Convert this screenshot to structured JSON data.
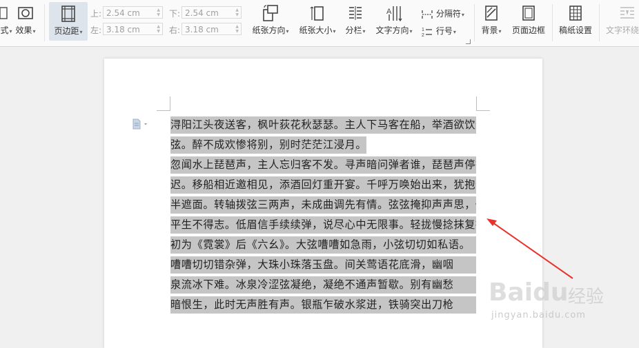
{
  "toolbar": {
    "left_label": "式",
    "effects_label": "效果",
    "margins_label": "页边距",
    "margins": {
      "top_label": "上:",
      "top_value": "2.54 cm",
      "bottom_label": "下:",
      "bottom_value": "2.54 cm",
      "left_label": "左:",
      "left_value": "3.18 cm",
      "right_label": "右:",
      "right_value": "3.18 cm"
    },
    "orientation_label": "纸张方向",
    "paper_size_label": "纸张大小",
    "columns_label": "分栏",
    "text_direction_label": "文字方向",
    "breaks_label": "分隔符",
    "line_numbers_label": "行号",
    "background_label": "背景",
    "page_border_label": "页面边框",
    "manuscript_label": "稿纸设置",
    "text_wrap_label": "文字环绕"
  },
  "document": {
    "lines": [
      {
        "text": "浔阳江头夜送客，枫叶荻花秋瑟瑟。主人下马客在船，举酒欲饮无管",
        "full": true
      },
      {
        "text": "弦。醉不成欢惨将别，别时茫茫江浸月。",
        "full": false
      },
      {
        "text": "忽闻水上琵琶声，主人忘归客不发。寻声暗问弹者谁，琵琶声停欲语",
        "full": true
      },
      {
        "text": "迟。移船相近邀相见，添酒回灯重开宴。千呼万唤始出来，犹抱琵琶",
        "full": true
      },
      {
        "text": "半遮面。转轴拨弦三两声，未成曲调先有情。弦弦掩抑声声思，似诉",
        "full": true
      },
      {
        "text": "平生不得志。低眉信手续续弹，说尽心中无限事。轻拢慢捻抹复挑，",
        "full": true
      },
      {
        "text": "初为《霓裳》后《六幺》。大弦嘈嘈如急雨，小弦切切如私语。",
        "full": true
      },
      {
        "text": "嘈嘈切切错杂弹，大珠小珠落玉盘。间关莺语花底滑，幽咽",
        "full": true
      },
      {
        "text": "泉流冰下难。冰泉冷涩弦凝绝，凝绝不通声暂歇。别有幽愁",
        "full": true
      },
      {
        "text": "暗恨生，此时无声胜有声。银瓶乍破水浆迸，铁骑突出刀枪",
        "full": true
      }
    ]
  },
  "watermark": {
    "brand": "Baidu",
    "brand_cn": "经验",
    "url": "jingyan.baidu.com"
  },
  "colors": {
    "highlight": "#c5c5c5",
    "arrow": "#e8322b",
    "ribbon_bg": "#fafafa",
    "page_bg": "#ffffff"
  }
}
